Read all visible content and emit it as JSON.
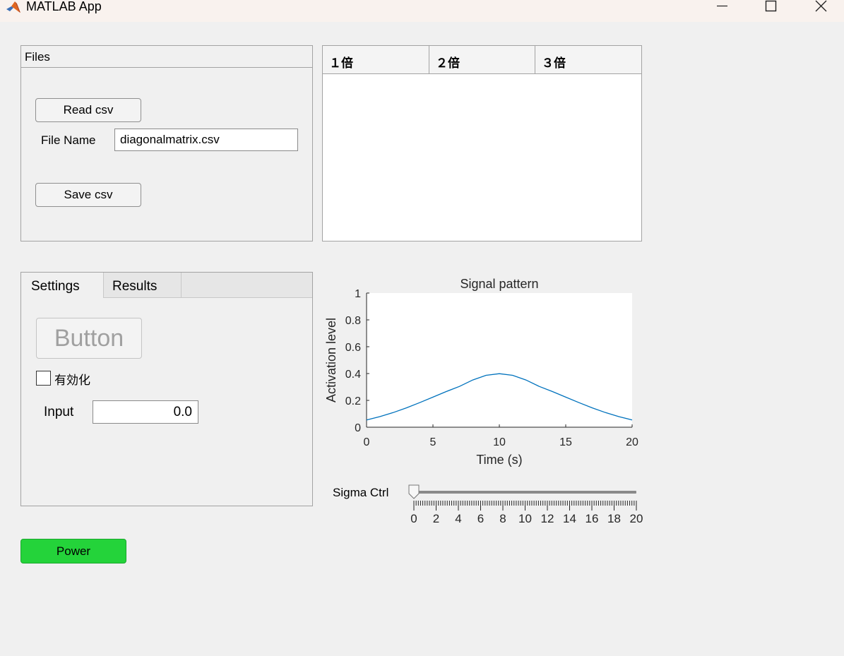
{
  "window": {
    "title": "MATLAB App",
    "minimize_icon": "minimize-icon",
    "maximize_icon": "maximize-icon",
    "close_icon": "close-icon"
  },
  "files_panel": {
    "title": "Files",
    "read_button": "Read csv",
    "file_name_label": "File Name",
    "file_name_value": "diagonalmatrix.csv",
    "save_button": "Save csv"
  },
  "table": {
    "columns": [
      "１倍",
      "２倍",
      "３倍"
    ],
    "rows": []
  },
  "tabs": {
    "items": [
      "Settings",
      "Results"
    ],
    "selected": "Settings",
    "settings": {
      "button_label": "Button",
      "checkbox_label": "有効化",
      "checkbox_checked": false,
      "input_label": "Input",
      "input_value": "0.0"
    }
  },
  "chart_data": {
    "type": "line",
    "title": "Signal pattern",
    "xlabel": "Time (s)",
    "ylabel": "Activation level",
    "xlim": [
      0,
      20
    ],
    "ylim": [
      0,
      1
    ],
    "xticks": [
      "0",
      "5",
      "10",
      "15",
      "20"
    ],
    "yticks": [
      "0",
      "0.2",
      "0.4",
      "0.6",
      "0.8",
      "1"
    ],
    "grid": false,
    "series": [
      {
        "color": "#0072bd",
        "x": [
          0,
          1,
          2,
          3,
          4,
          5,
          6,
          7,
          8,
          9,
          10,
          11,
          12,
          13,
          14,
          15,
          16,
          17,
          18,
          19,
          20
        ],
        "y": [
          0.054,
          0.079,
          0.109,
          0.144,
          0.183,
          0.224,
          0.266,
          0.304,
          0.352,
          0.387,
          0.399,
          0.387,
          0.352,
          0.304,
          0.266,
          0.224,
          0.183,
          0.144,
          0.109,
          0.079,
          0.054
        ]
      }
    ]
  },
  "slider": {
    "label": "Sigma Ctrl",
    "value": 0,
    "min": 0,
    "max": 20,
    "tick_labels": [
      "0",
      "2",
      "4",
      "6",
      "8",
      "10",
      "12",
      "14",
      "16",
      "18",
      "20"
    ]
  },
  "power_button": {
    "label": "Power",
    "color": "#24d33a"
  }
}
